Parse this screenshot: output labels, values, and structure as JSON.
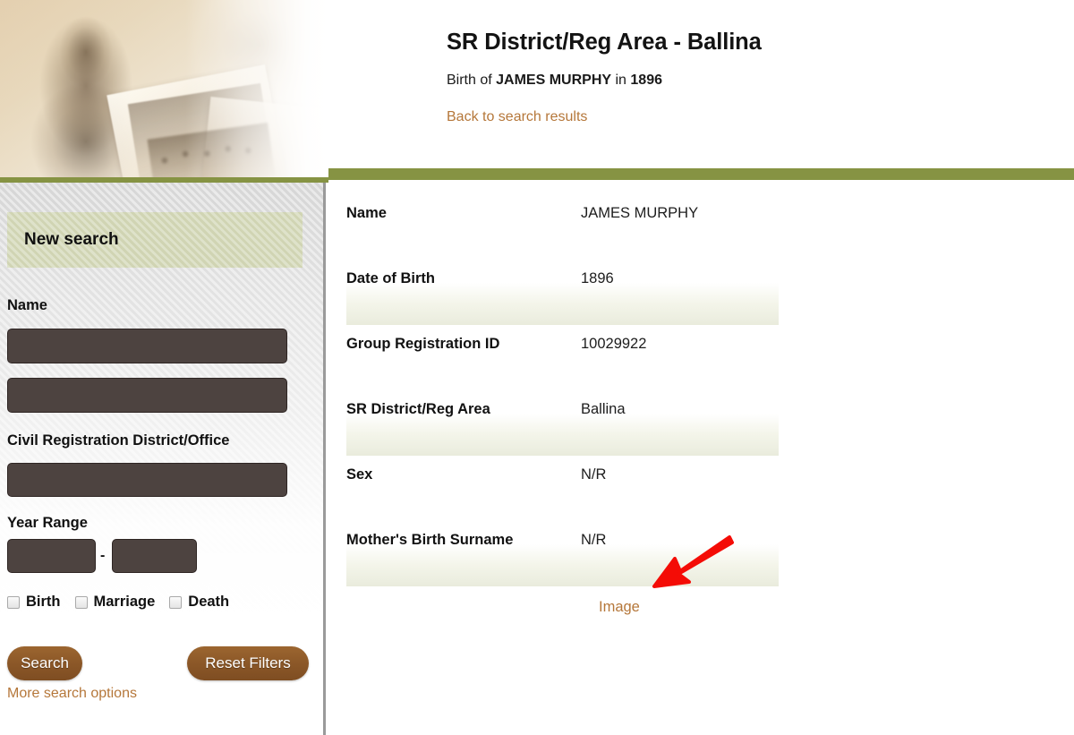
{
  "header": {
    "title": "SR District/Reg Area - Ballina",
    "subtitle_prefix": "Birth of ",
    "subtitle_name": "JAMES MURPHY",
    "subtitle_middle": " in ",
    "subtitle_year": "1896",
    "back_link": "Back to search results",
    "banner_alt": "vintage-sepia-portrait-photographs",
    "green_bar_color": "#869343",
    "link_color": "#b5773a"
  },
  "sidebar": {
    "panel_title": "New search",
    "fields": {
      "name_label": "Name",
      "first_name_value": "",
      "first_name_placeholder": "",
      "last_name_value": "",
      "last_name_placeholder": "",
      "district_label": "Civil Registration District/Office",
      "district_value": "",
      "district_placeholder": "",
      "year_range_label": "Year Range",
      "year_from_value": "",
      "year_from_placeholder": "",
      "year_to_value": "",
      "year_to_placeholder": "",
      "year_separator": "-"
    },
    "record_types": [
      {
        "label": "Birth",
        "checked": false
      },
      {
        "label": "Marriage",
        "checked": false
      },
      {
        "label": "Death",
        "checked": false
      }
    ],
    "buttons": {
      "search": "Search",
      "reset": "Reset Filters"
    },
    "more_options_link": "More search options",
    "input_color": "#4d4340",
    "button_color": "#8c5828",
    "panel_header_color": "#d2d7b5"
  },
  "main": {
    "rows": [
      {
        "label": "Name",
        "value": "JAMES MURPHY",
        "striped": false
      },
      {
        "label": "Date of Birth",
        "value": "1896",
        "striped": true
      },
      {
        "label": "Group Registration ID",
        "value": "10029922",
        "striped": false
      },
      {
        "label": "SR District/Reg Area",
        "value": "Ballina",
        "striped": true
      },
      {
        "label": "Sex",
        "value": "N/R",
        "striped": false
      },
      {
        "label": "Mother's Birth Surname",
        "value": "N/R",
        "striped": true
      }
    ],
    "image_link": "Image",
    "stripe_color": "#eceee0"
  },
  "annotation": {
    "arrow_name": "red-arrow-pointing-to-image-link",
    "arrow_color": "#f40c06"
  }
}
